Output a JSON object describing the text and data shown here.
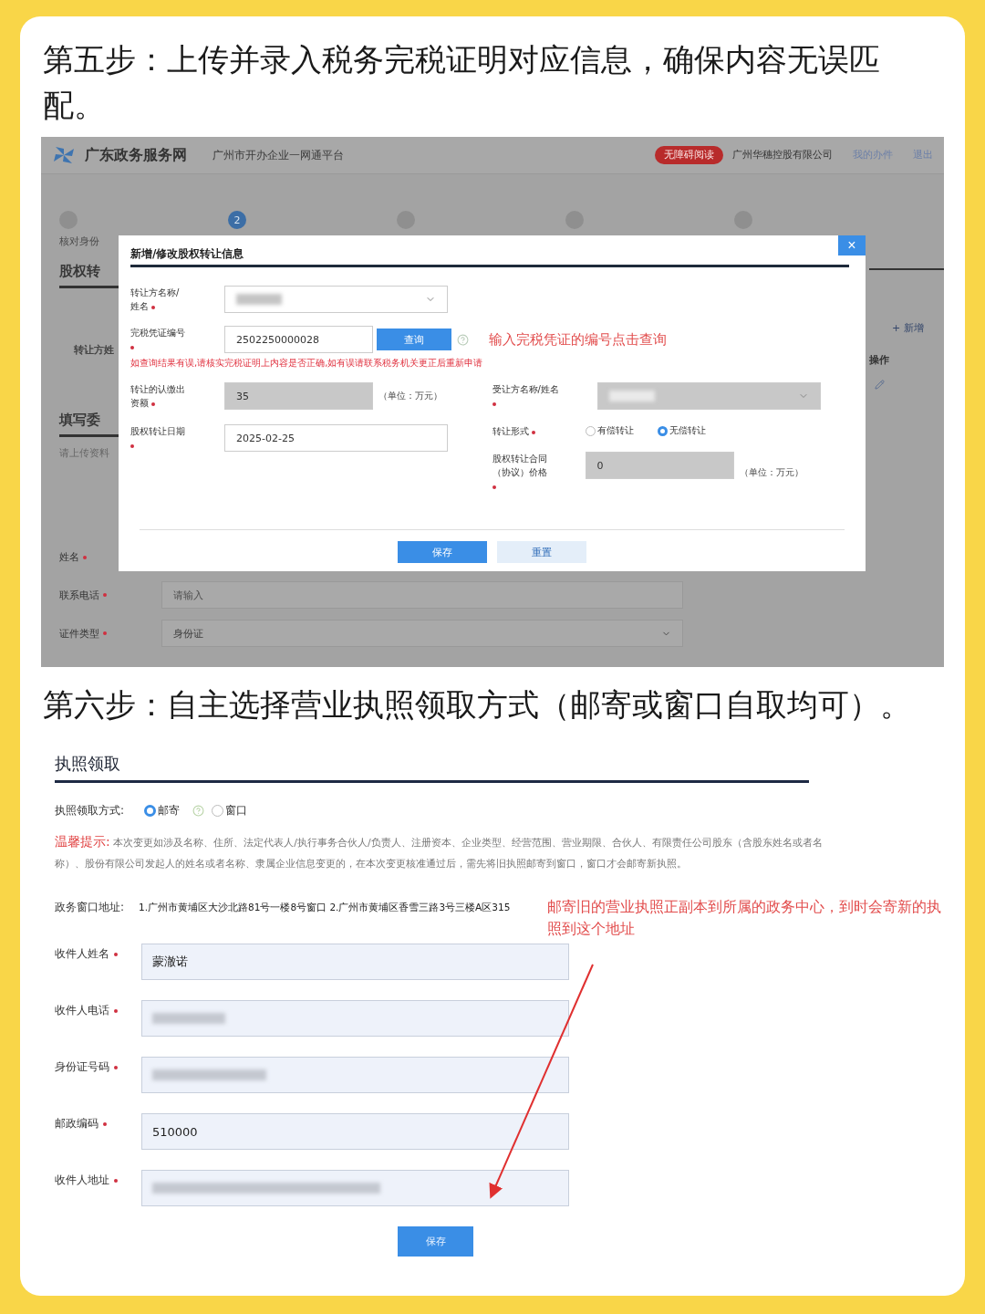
{
  "step5": {
    "heading": "第五步：上传并录入税务完税证明对应信息，确保内容无误匹配。"
  },
  "portal": {
    "site_name": "广东政务服务网",
    "platform": "广州市开办企业一网通平台",
    "accessibility_button": "无障碍阅读",
    "company": "广州华穗控股有限公司",
    "links": [
      "我的办件",
      "退出"
    ],
    "progress_steps": [
      {
        "label": "核对身份",
        "selected": false
      },
      {
        "number": "2",
        "selected": true
      },
      {
        "selected": false
      },
      {
        "selected": false
      },
      {
        "selected": false
      }
    ]
  },
  "background": {
    "section_title": "股权转",
    "table_header": "转让方姓",
    "add_button": "+ 新增",
    "action_header": "操作",
    "section_title_2": "填写委",
    "upload_hint": "请上传资料",
    "fields": [
      {
        "label": "姓名",
        "required": true,
        "kind": "text"
      },
      {
        "label": "联系电话",
        "required": true,
        "kind": "text",
        "placeholder": "请输入"
      },
      {
        "label": "证件类型",
        "required": true,
        "kind": "select",
        "value": "身份证"
      }
    ]
  },
  "dialog": {
    "title": "新增/修改股权转让信息",
    "close": "×",
    "top_fields": [
      {
        "label": "转让方名称/姓名",
        "required": true,
        "kind": "select",
        "redacted": true
      },
      {
        "label": "完税凭证编号",
        "required": true,
        "kind": "query",
        "value": "2502250000028",
        "button": "查询"
      }
    ],
    "error": "如查询结果有误,请核实完税证明上内容是否正确,如有误请联系税务机关更正后重新申请",
    "annotation": "输入完税凭证的编号点击查询",
    "left_fields": [
      {
        "label": "转让的认缴出资额",
        "required": true,
        "kind": "readonly",
        "value": "35",
        "unit": "（单位：万元）"
      },
      {
        "label": "股权转让日期",
        "required": true,
        "kind": "text",
        "value": "2025-02-25"
      }
    ],
    "right_fields": [
      {
        "label": "受让方名称/姓名",
        "required": true,
        "kind": "select_readonly",
        "redacted": true
      },
      {
        "label": "转让形式",
        "required": true,
        "kind": "radio",
        "options": [
          {
            "label": "有偿转让",
            "selected": false
          },
          {
            "label": "无偿转让",
            "selected": true
          }
        ]
      },
      {
        "label": "股权转让合同（协议）价格",
        "required": true,
        "kind": "readonly",
        "value": "0",
        "unit": "（单位：万元）"
      }
    ],
    "buttons": [
      {
        "label": "保存",
        "kind": "primary"
      },
      {
        "label": "重置",
        "kind": "secondary"
      }
    ]
  },
  "step6": {
    "heading": "第六步：自主选择营业执照领取方式（邮寄或窗口自取均可）。"
  },
  "license_pickup": {
    "title": "执照领取",
    "method_label": "执照领取方式:",
    "methods": [
      {
        "label": "邮寄",
        "selected": true
      },
      {
        "label": "窗口",
        "selected": false
      }
    ],
    "tip_label": "温馨提示:",
    "tip": "本次变更如涉及名称、住所、法定代表人/执行事务合伙人/负责人、注册资本、企业类型、经营范围、营业期限、合伙人、有限责任公司股东（含股东姓名或者名称）、股份有限公司发起人的姓名或者名称、隶属企业信息变更的，在本次变更核准通过后，需先将旧执照邮寄到窗口，窗口才会邮寄新执照。",
    "window_address_label": "政务窗口地址:",
    "window_address": "1.广州市黄埔区大沙北路81号一楼8号窗口 2.广州市黄埔区香雪三路3号三楼A区315",
    "annotation": "邮寄旧的营业执照正副本到所属的政务中心，到时会寄新的执照到这个地址",
    "fields": [
      {
        "label": "收件人姓名",
        "required": true,
        "value": "蒙澈诺"
      },
      {
        "label": "收件人电话",
        "required": true,
        "redacted": true
      },
      {
        "label": "身份证号码",
        "required": true,
        "redacted": true
      },
      {
        "label": "邮政编码",
        "required": true,
        "value": "510000"
      },
      {
        "label": "收件人地址",
        "required": true,
        "redacted": true
      }
    ],
    "save_button": "保存"
  }
}
